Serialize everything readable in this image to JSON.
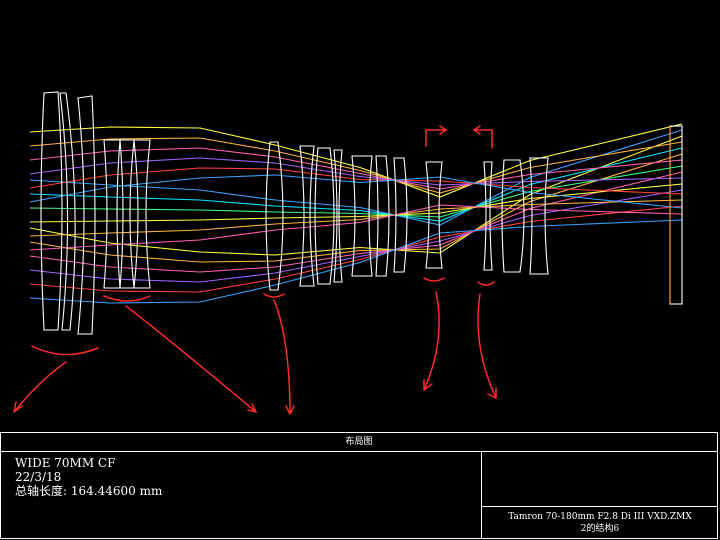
{
  "title_block": {
    "header": "布局图",
    "config_name": "WIDE 70MM CF",
    "date": "22/3/18",
    "axis_length_label": "总轴长度:",
    "axis_length_value": "164.44600 mm",
    "file_name": "Tamron 70-180mm F2.8 Di III VXD.ZMX",
    "configuration": "2的结构6"
  },
  "colors": {
    "background": "#000000",
    "lens_outline": "#ffffff",
    "annotation": "#ff2a2a",
    "ray_fields": [
      "#3aa0ff",
      "#00e5ff",
      "#40ff80",
      "#ffff40",
      "#ffb040",
      "#ff60b0",
      "#a060ff",
      "#ff4040"
    ]
  }
}
